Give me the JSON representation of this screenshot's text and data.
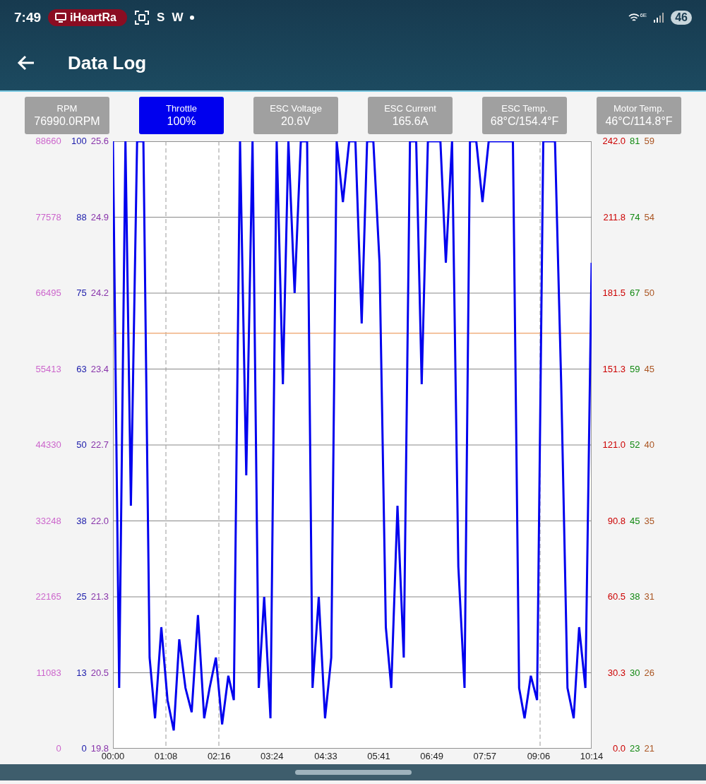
{
  "status_bar": {
    "time": "7:49",
    "media_chip": "iHeartRa",
    "app_letters": [
      "S",
      "W"
    ],
    "network": "6E",
    "battery": "46"
  },
  "app_bar": {
    "title": "Data Log"
  },
  "metrics": [
    {
      "label": "RPM",
      "value": "76990.0RPM",
      "selected": false
    },
    {
      "label": "Throttle",
      "value": "100%",
      "selected": true
    },
    {
      "label": "ESC Voltage",
      "value": "20.6V",
      "selected": false
    },
    {
      "label": "ESC Current",
      "value": "165.6A",
      "selected": false
    },
    {
      "label": "ESC Temp.",
      "value": "68°C/154.4°F",
      "selected": false
    },
    {
      "label": "Motor Temp.",
      "value": "46°C/114.8°F",
      "selected": false
    }
  ],
  "chart": {
    "left_axes": [
      {
        "color": "#cc66cc",
        "ticks": [
          "88660",
          "77578",
          "66495",
          "55413",
          "44330",
          "33248",
          "22165",
          "11083",
          "0"
        ]
      },
      {
        "color": "#1a1aaa"
      },
      {
        "color": "#8833aa",
        "ticks": [
          "25.6",
          "24.9",
          "24.2",
          "23.4",
          "22.7",
          "22.0",
          "21.3",
          "20.5",
          "19.8"
        ]
      }
    ],
    "right_axes": [
      {
        "color": "#cc0000",
        "ticks": [
          "242.0",
          "211.8",
          "181.5",
          "151.3",
          "121.0",
          "90.8",
          "60.5",
          "30.3",
          "0.0"
        ]
      },
      {
        "color": "#118811",
        "ticks": [
          "81",
          "74",
          "67",
          "59",
          "52",
          "45",
          "38",
          "30",
          "23"
        ]
      },
      {
        "color": "#aa5522",
        "ticks": [
          "59",
          "54",
          "50",
          "45",
          "40",
          "35",
          "31",
          "26",
          "21"
        ]
      }
    ],
    "chart_data": {
      "type": "line",
      "ylim": [
        0,
        100
      ],
      "xlim": [
        0,
        614
      ],
      "x": [
        0,
        8,
        16,
        23,
        31,
        39,
        47,
        54,
        62,
        70,
        78,
        85,
        93,
        101,
        109,
        117,
        124,
        132,
        140,
        148,
        155,
        163,
        171,
        179,
        187,
        194,
        202,
        210,
        218,
        225,
        233,
        241,
        249,
        256,
        264,
        272,
        280,
        287,
        295,
        303,
        311,
        319,
        326,
        334,
        342,
        350,
        357,
        365,
        373,
        381,
        389,
        396,
        404,
        412,
        420,
        427,
        435,
        443,
        451,
        458,
        466,
        474,
        482,
        490,
        497,
        505,
        513,
        521,
        528,
        536,
        544,
        552,
        559,
        567,
        575,
        583,
        591,
        598,
        606,
        614
      ],
      "xticks": [
        {
          "value": 0,
          "label": "00:00"
        },
        {
          "value": 68,
          "label": "01:08"
        },
        {
          "value": 136,
          "label": "02:16"
        },
        {
          "value": 204,
          "label": "03:24"
        },
        {
          "value": 273,
          "label": "04:33"
        },
        {
          "value": 341,
          "label": "05:41"
        },
        {
          "value": 409,
          "label": "06:49"
        },
        {
          "value": 477,
          "label": "07:57"
        },
        {
          "value": 546,
          "label": "09:06"
        },
        {
          "value": 614,
          "label": "10:14"
        }
      ],
      "yticks": [
        {
          "value": 100,
          "label": "100"
        },
        {
          "value": 87.5,
          "label": "88"
        },
        {
          "value": 75,
          "label": "75"
        },
        {
          "value": 62.5,
          "label": "63"
        },
        {
          "value": 50,
          "label": "50"
        },
        {
          "value": 37.5,
          "label": "38"
        },
        {
          "value": 25,
          "label": "25"
        },
        {
          "value": 12.5,
          "label": "13"
        },
        {
          "value": 0,
          "label": "0"
        }
      ],
      "ref_lines": [
        {
          "axis": "y",
          "value": 68.4,
          "color": "#f0b080"
        }
      ],
      "grid": true,
      "series": [
        {
          "color": "#0000ee",
          "values": [
            100,
            10,
            100,
            40,
            100,
            100,
            15,
            5,
            20,
            8,
            3,
            18,
            10,
            6,
            22,
            5,
            10,
            15,
            4,
            12,
            8,
            100,
            45,
            100,
            10,
            25,
            5,
            100,
            60,
            100,
            75,
            100,
            100,
            10,
            25,
            5,
            15,
            100,
            90,
            100,
            100,
            70,
            100,
            100,
            80,
            20,
            10,
            40,
            15,
            100,
            100,
            60,
            100,
            100,
            100,
            80,
            100,
            30,
            10,
            100,
            100,
            90,
            100,
            100,
            100,
            100,
            100,
            10,
            5,
            12,
            8,
            100,
            100,
            100,
            60,
            10,
            5,
            20,
            10,
            80
          ]
        }
      ]
    }
  }
}
